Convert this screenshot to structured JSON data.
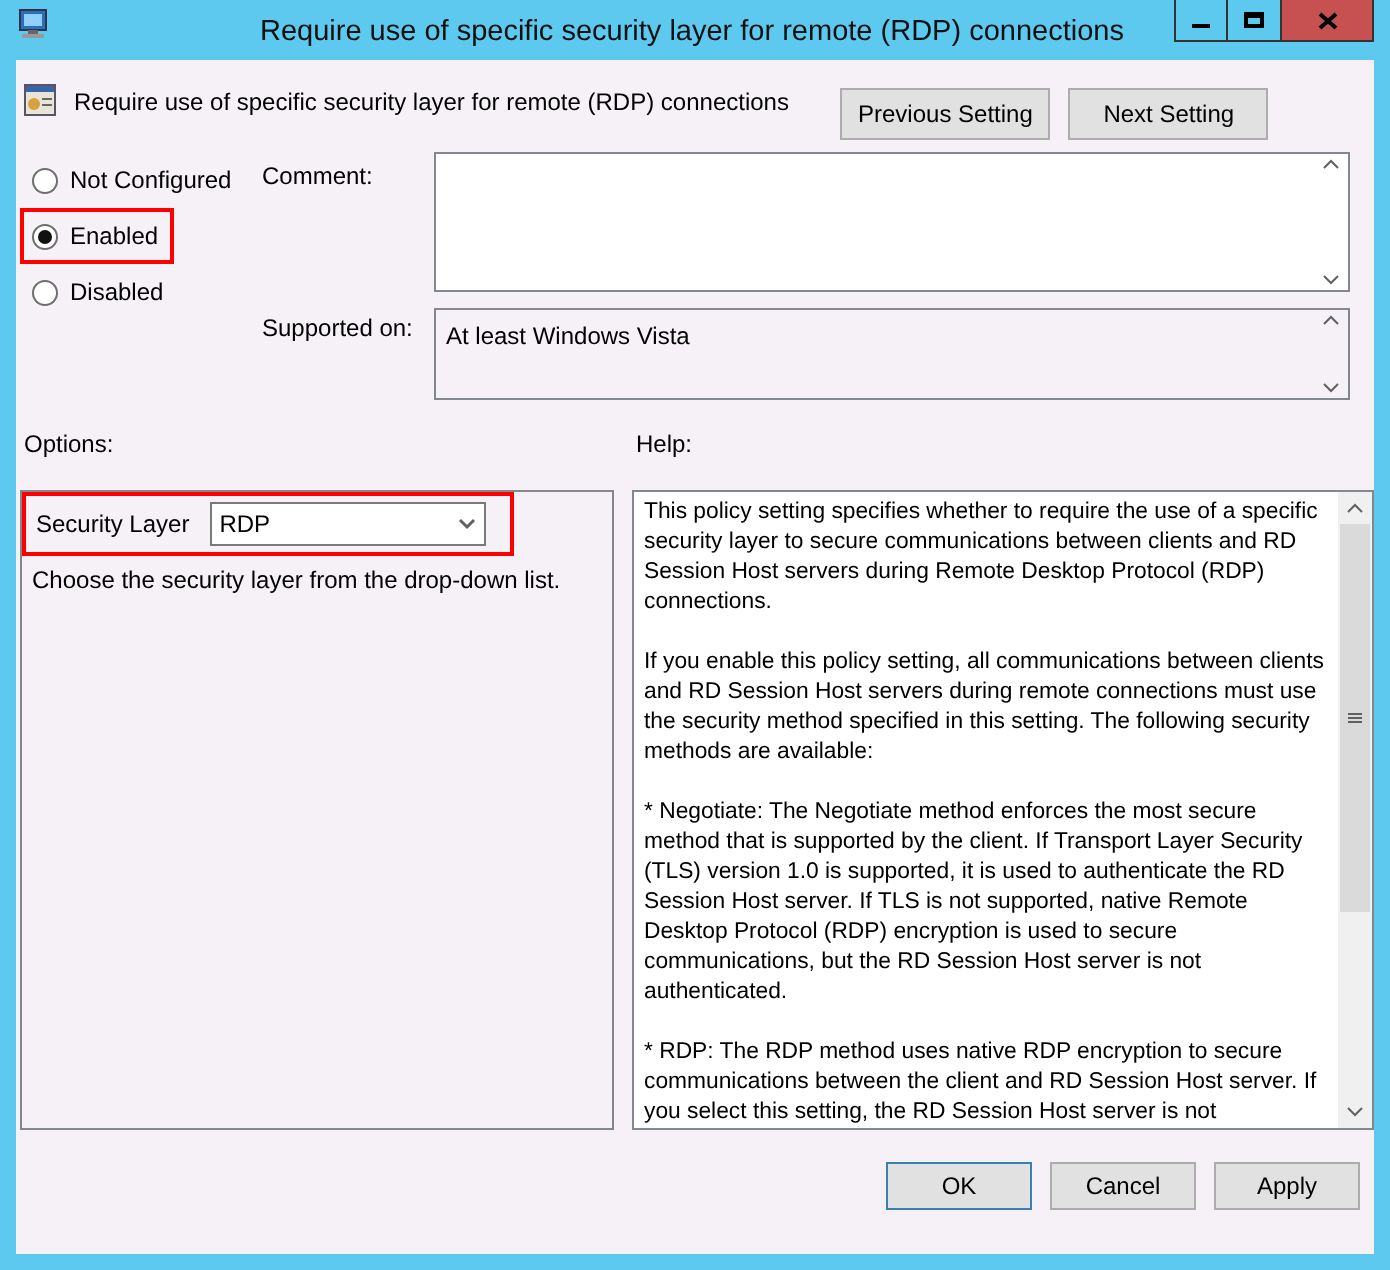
{
  "window": {
    "title": "Require use of specific security layer for remote (RDP) connections"
  },
  "header": {
    "policy_name": "Require use of specific security layer for remote (RDP) connections"
  },
  "nav_buttons": [
    {
      "label": "Previous Setting"
    },
    {
      "label": "Next Setting"
    }
  ],
  "state_options": [
    {
      "label": "Not Configured",
      "selected": false,
      "highlighted": false
    },
    {
      "label": "Enabled",
      "selected": true,
      "highlighted": true
    },
    {
      "label": "Disabled",
      "selected": false,
      "highlighted": false
    }
  ],
  "comment": {
    "label": "Comment:"
  },
  "supported_on": {
    "label": "Supported on:",
    "value": "At least Windows Vista"
  },
  "options": {
    "label": "Options:",
    "field_label": "Security Layer",
    "value": "RDP",
    "highlighted": true,
    "description": "Choose the security layer from the drop-down list."
  },
  "help": {
    "label": "Help:",
    "paragraphs": [
      "This policy setting specifies whether to require the use of a specific security layer to secure communications between clients and RD Session Host servers during Remote Desktop Protocol (RDP) connections.",
      "If you enable this policy setting, all communications between clients and RD Session Host servers during remote connections must use the security method specified in this setting. The following security methods are available:",
      "* Negotiate: The Negotiate method enforces the most secure method that is supported by the client. If Transport Layer Security (TLS) version 1.0 is supported, it is used to authenticate the RD Session Host server. If TLS is not supported, native Remote Desktop Protocol (RDP) encryption is used to secure communications, but the RD Session Host server is not authenticated.",
      "* RDP: The RDP method uses native RDP encryption to secure communications between the client and RD Session Host server. If you select this setting, the RD Session Host server is not"
    ]
  },
  "footer_buttons": [
    {
      "label": "OK",
      "default": true
    },
    {
      "label": "Cancel",
      "default": false
    },
    {
      "label": "Apply",
      "default": false
    }
  ]
}
